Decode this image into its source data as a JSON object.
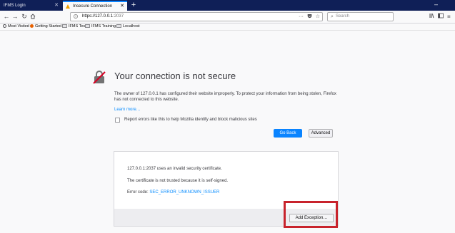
{
  "browser": {
    "tabs": [
      {
        "label": "IFMS Login",
        "active": false
      },
      {
        "label": "Insecure Connection",
        "active": true
      }
    ],
    "url_base": "https://127.0.0.1",
    "url_port": ":2037",
    "search_placeholder": "Search",
    "bookmarks": [
      {
        "label": "Most Visited",
        "icon": "gear-icon"
      },
      {
        "label": "Getting Started",
        "icon": "firefox-icon"
      },
      {
        "label": "IFMS Test",
        "icon": "folder-icon"
      },
      {
        "label": "IFMS Training",
        "icon": "folder-icon"
      },
      {
        "label": "Localhost",
        "icon": "folder-icon"
      }
    ]
  },
  "page": {
    "title": "Your connection is not secure",
    "description": "The owner of 127.0.0.1 has configured their website improperly. To protect your information from being stolen, Firefox has not connected to this website.",
    "learn_more": "Learn more…",
    "report_checkbox_label": "Report errors like this to help Mozilla identify and block malicious sites",
    "go_back_label": "Go Back",
    "advanced_label": "Advanced",
    "advanced_panel": {
      "line1": "127.0.0.1:2037 uses an invalid security certificate.",
      "line2": "The certificate is not trusted because it is self-signed.",
      "error_prefix": "Error code: ",
      "error_code": "SEC_ERROR_UNKNOWN_ISSUER",
      "add_exception_label": "Add Exception…"
    }
  },
  "colors": {
    "tabstrip": "#0f1f57",
    "accent": "#0a84ff",
    "highlight": "#c8232c"
  }
}
